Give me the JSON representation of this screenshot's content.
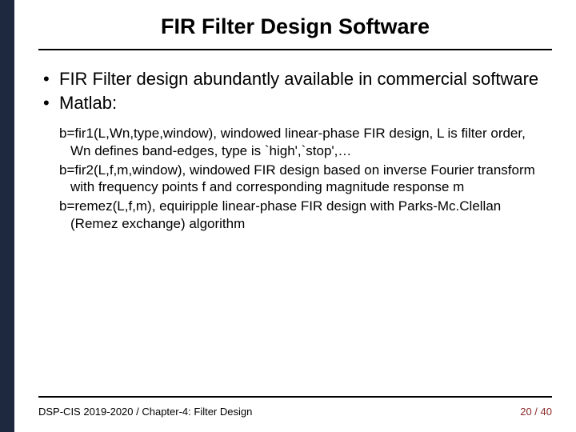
{
  "title": "FIR Filter Design Software",
  "bullets": [
    "FIR Filter design abundantly available in commercial software",
    "Matlab:"
  ],
  "codeItems": [
    "b=fir1(L,Wn,type,window), windowed linear-phase FIR design, L is filter order, Wn defines band-edges, type is `high',`stop',…",
    "b=fir2(L,f,m,window),  windowed FIR design based on inverse Fourier transform with frequency points f and corresponding magnitude response m",
    "b=remez(L,f,m), equiripple linear-phase FIR design with Parks-Mc.Clellan (Remez exchange) algorithm"
  ],
  "footer": {
    "left": "DSP-CIS 2019-2020  /   Chapter-4: Filter Design",
    "page": "20 / 40"
  }
}
